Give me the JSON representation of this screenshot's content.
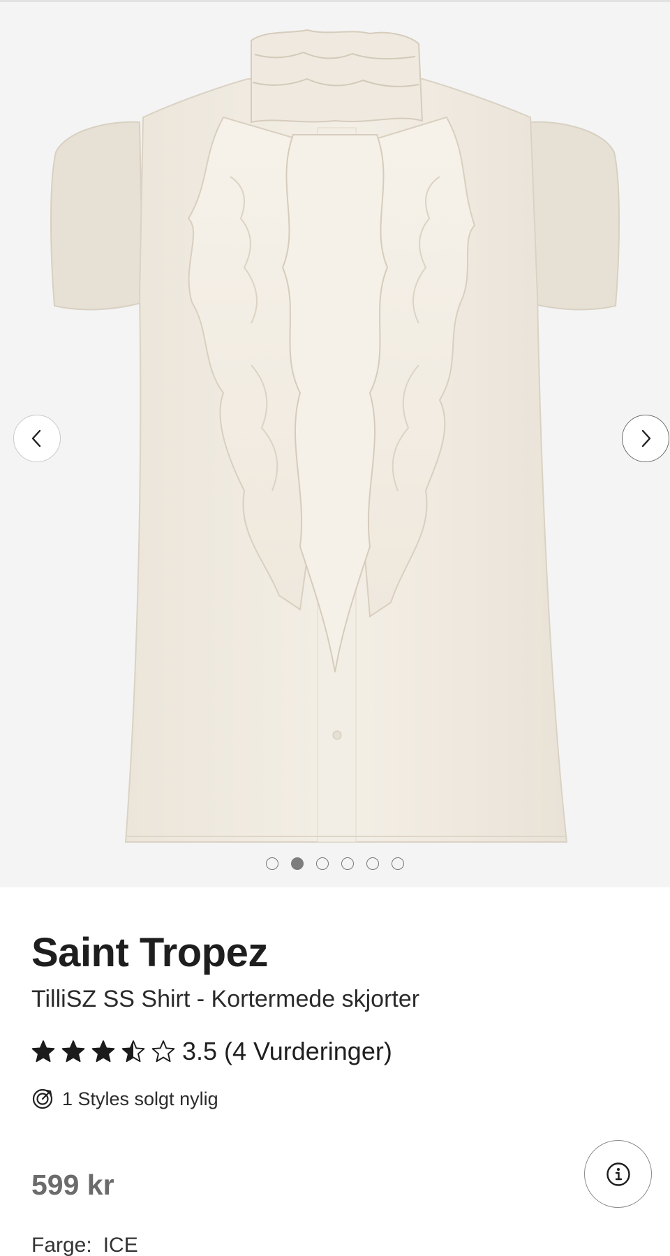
{
  "gallery": {
    "image_alt": "TilliSZ SS Shirt",
    "dot_count": 6,
    "active_index": 1,
    "prev_icon": "chevron-left-icon",
    "next_icon": "chevron-right-icon"
  },
  "product": {
    "brand": "Saint Tropez",
    "name": "TilliSZ SS Shirt - Kortermede skjorter",
    "rating": {
      "value": 3.5,
      "max": 5,
      "text": "3.5 (4 Vurderinger)"
    },
    "sold_text": "1 Styles solgt nylig",
    "sold_icon": "target-check-icon",
    "price": "599 kr",
    "info_icon": "info-icon",
    "color_label": "Farge:",
    "color_value": "ICE"
  },
  "colors": {
    "gallery_bg": "#f4f4f4",
    "star": "#1b1b1b",
    "price": "#6b6b6b",
    "dot_active": "#7d7d7d"
  }
}
